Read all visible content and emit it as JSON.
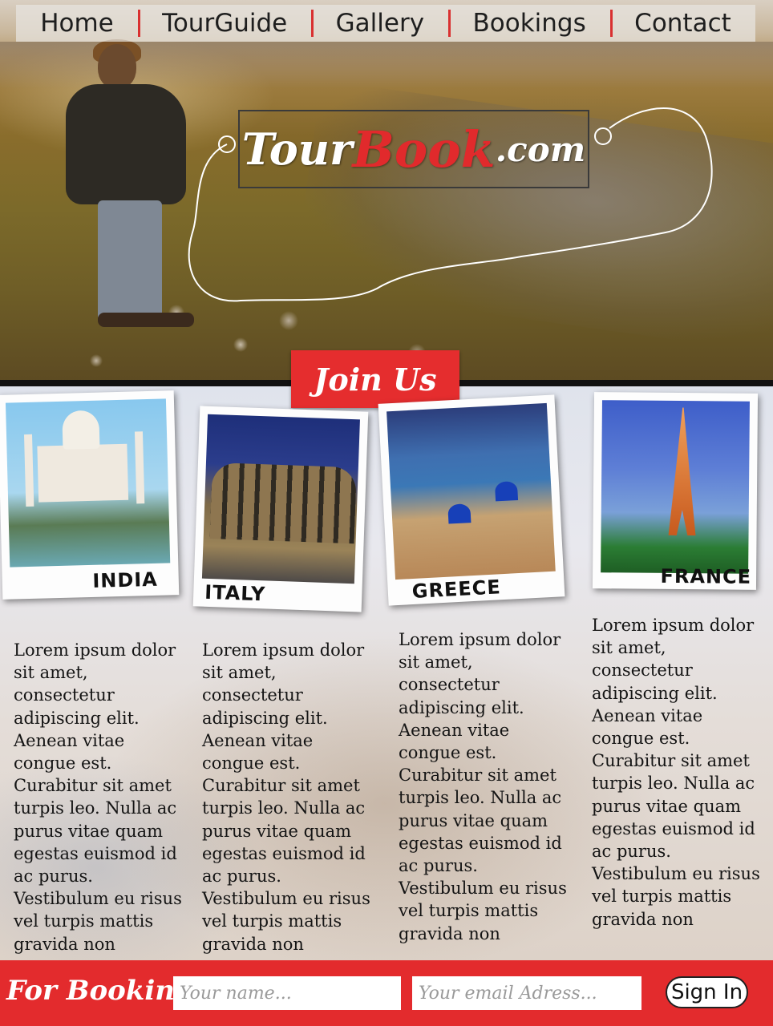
{
  "nav": {
    "items": [
      "Home",
      "TourGuide",
      "Gallery",
      "Bookings",
      "Contact"
    ]
  },
  "logo": {
    "part1": "Tour",
    "part2": "Book",
    "part3": ".com"
  },
  "join_button": "Join Us",
  "destinations": [
    {
      "label": "INDIA",
      "text": "Lorem ipsum dolor sit amet, consectetur adipiscing elit. Aenean vitae congue est. Curabitur sit amet turpis leo. Nulla ac purus vitae quam egestas euismod id ac purus. Vestibulum eu risus vel turpis mattis gravida non"
    },
    {
      "label": "ITALY",
      "text": "Lorem ipsum dolor sit amet, consectetur adipiscing elit. Aenean vitae congue est. Curabitur sit amet turpis leo. Nulla ac purus vitae quam egestas euismod id ac purus. Vestibulum eu risus vel turpis mattis gravida non"
    },
    {
      "label": "GREECE",
      "text": "Lorem ipsum dolor sit amet, consectetur adipiscing elit. Aenean vitae congue est. Curabitur sit amet turpis leo. Nulla ac purus vitae quam egestas euismod id ac purus. Vestibulum eu risus vel turpis mattis gravida non"
    },
    {
      "label": "FRANCE",
      "text": "Lorem ipsum dolor sit amet, consectetur adipiscing elit. Aenean vitae congue est. Curabitur sit amet turpis leo. Nulla ac purus vitae quam egestas euismod id ac purus. Vestibulum eu risus vel turpis mattis gravida non"
    }
  ],
  "footer": {
    "label": "For Booking:",
    "name_placeholder": "Your name...",
    "email_placeholder": "Your email Adress...",
    "signin": "Sign In"
  },
  "colors": {
    "accent": "#e32b2d",
    "nav_divider": "#d93030"
  }
}
